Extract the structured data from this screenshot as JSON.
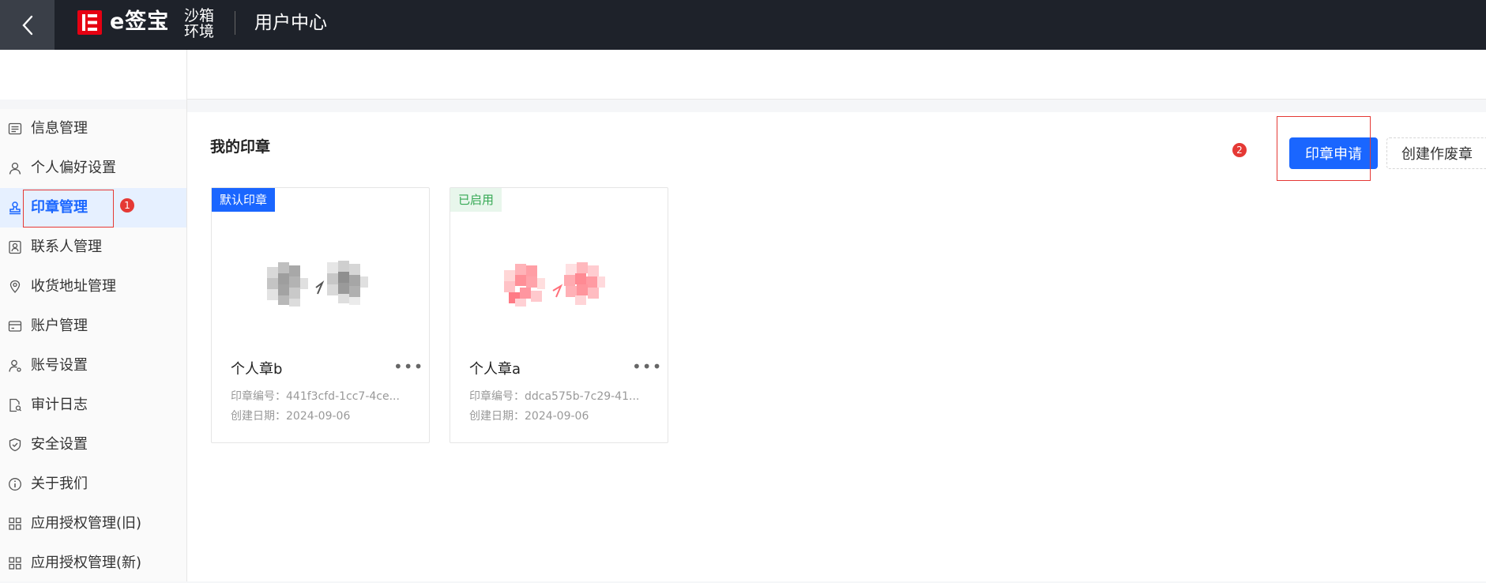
{
  "topbar": {
    "logo_text": "e签宝",
    "logo_mark": "E",
    "sandbox_label": "沙箱环境",
    "title": "用户中心"
  },
  "sidebar": {
    "items": [
      {
        "label": "信息管理",
        "icon": "info-card-icon"
      },
      {
        "label": "个人偏好设置",
        "icon": "user-icon"
      },
      {
        "label": "印章管理",
        "icon": "stamp-icon",
        "active": true
      },
      {
        "label": "联系人管理",
        "icon": "contact-icon"
      },
      {
        "label": "收货地址管理",
        "icon": "location-icon"
      },
      {
        "label": "账户管理",
        "icon": "wallet-icon"
      },
      {
        "label": "账号设置",
        "icon": "user-settings-icon"
      },
      {
        "label": "审计日志",
        "icon": "audit-log-icon"
      },
      {
        "label": "安全设置",
        "icon": "shield-icon"
      },
      {
        "label": "关于我们",
        "icon": "info-circle-icon"
      },
      {
        "label": "应用授权管理(旧)",
        "icon": "apps-grid-icon"
      },
      {
        "label": "应用授权管理(新)",
        "icon": "apps-grid-icon"
      }
    ]
  },
  "main": {
    "title": "我的印章",
    "apply_button": "印章申请",
    "create_void_button": "创建作废章",
    "seals": [
      {
        "tag": "默认印章",
        "name": "个人章b",
        "number_label": "印章编号：",
        "number": "441f3cfd-1cc7-4ce...",
        "date_label": "创建日期：",
        "date": "2024-09-06",
        "more": "•••"
      },
      {
        "tag": "已启用",
        "name": "个人章a",
        "number_label": "印章编号：",
        "number": "ddca575b-7c29-41...",
        "date_label": "创建日期：",
        "date": "2024-09-06",
        "more": "•••"
      }
    ]
  },
  "annotations": {
    "badge1": "1",
    "badge2": "2",
    "color": "#e53935"
  },
  "colors": {
    "accent": "#1a66ff",
    "topbar": "#1e222a",
    "brand": "#e60012",
    "enabled_green": "#34a853"
  }
}
